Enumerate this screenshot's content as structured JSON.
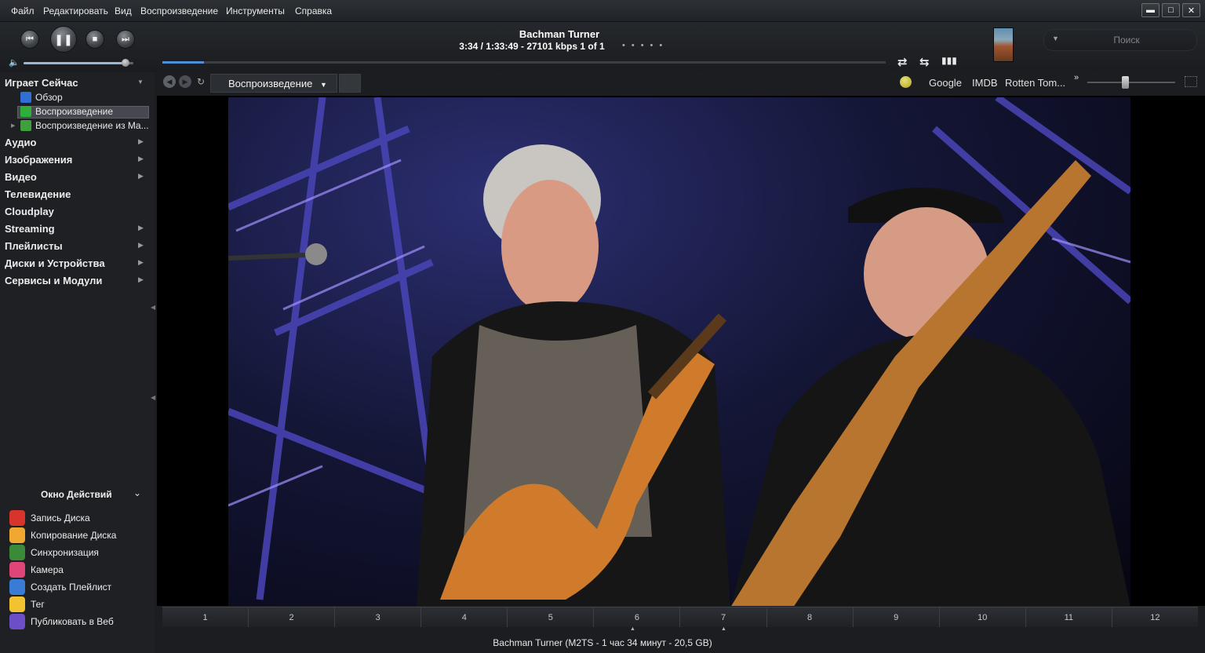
{
  "menu": [
    "Файл",
    "Редактировать",
    "Вид",
    "Воспроизведение",
    "Инструменты",
    "Справка"
  ],
  "window_controls": {
    "minimize": "▬",
    "maximize": "□",
    "close": "✕"
  },
  "now_playing": {
    "title": "Bachman Turner",
    "info": "3:34 / 1:33:49 - 27101 kbps   1 of 1",
    "progress": 0.058
  },
  "volume": 0.93,
  "search": {
    "placeholder": "Поиск"
  },
  "nav": {
    "tab_label": "Воспроизведение",
    "links": [
      "Google",
      "IMDB",
      "Rotten Tom..."
    ],
    "more": "»"
  },
  "sidebar": {
    "header": "Играет Сейчас",
    "sub_items": [
      {
        "label": "Обзор",
        "icon": "overview-icon"
      },
      {
        "label": "Воспроизведение",
        "icon": "play-icon",
        "selected": true
      },
      {
        "label": "Воспроизведение из Ma...",
        "icon": "playback-from-icon"
      }
    ],
    "items": [
      {
        "label": "Аудио",
        "arrow": true
      },
      {
        "label": "Изображения",
        "arrow": true
      },
      {
        "label": "Видео",
        "arrow": true
      },
      {
        "label": "Телевидение",
        "arrow": false
      },
      {
        "label": "Cloudplay",
        "arrow": false
      },
      {
        "label": "Streaming",
        "arrow": true
      },
      {
        "label": "Плейлисты",
        "arrow": true
      },
      {
        "label": "Диски и Устройства",
        "arrow": true
      },
      {
        "label": "Сервисы и Модули",
        "arrow": true
      }
    ]
  },
  "actions": {
    "title": "Окно Действий",
    "items": [
      {
        "label": "Запись Диска",
        "icon": "burn-disc-icon",
        "color": "#d6342c"
      },
      {
        "label": "Копирование Диска",
        "icon": "rip-disc-icon",
        "color": "#f0a830"
      },
      {
        "label": "Синхронизация",
        "icon": "sync-icon",
        "color": "#3a8a3a"
      },
      {
        "label": "Камера",
        "icon": "camera-icon",
        "color": "#e0457a"
      },
      {
        "label": "Создать Плейлист",
        "icon": "create-playlist-icon",
        "color": "#3a7bd5"
      },
      {
        "label": "Тег",
        "icon": "tag-icon",
        "color": "#f2c230"
      },
      {
        "label": "Публиковать в Веб",
        "icon": "publish-web-icon",
        "color": "#6a4fc8"
      }
    ]
  },
  "chapters": [
    "1",
    "2",
    "3",
    "4",
    "5",
    "6",
    "7",
    "8",
    "9",
    "10",
    "11",
    "12"
  ],
  "status": "Bachman Turner (M2TS - 1 час 34 минут - 20,5 GB)",
  "colors": {
    "accent": "#4e8fd6",
    "background": "#1b1d20",
    "sidebar": "#1e2024"
  }
}
